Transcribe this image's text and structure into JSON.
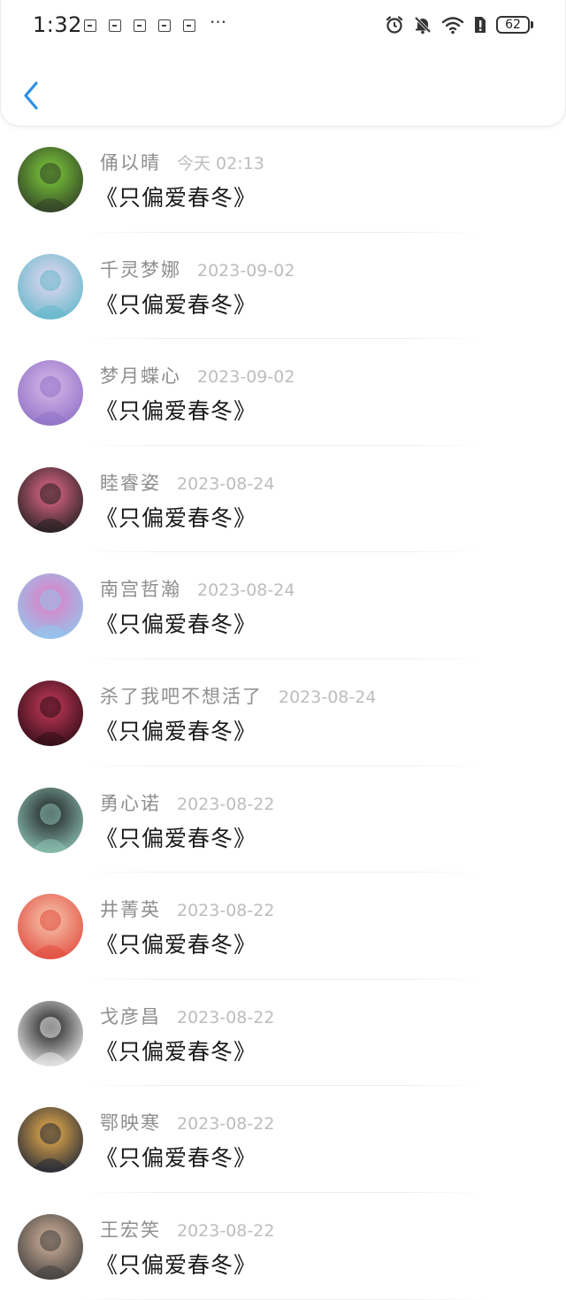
{
  "status_bar": {
    "time": "1:32",
    "battery": "62",
    "more": "···"
  },
  "nav": {
    "accent_color": "#2b8fe6"
  },
  "messages": [
    {
      "name": "俑以晴",
      "date": "今天 02:13",
      "text": "《只偏爱春冬》",
      "avatar_colors": [
        "#2d3a26",
        "#7fcf3a"
      ]
    },
    {
      "name": "千灵梦娜",
      "date": "2023-09-02",
      "text": "《只偏爱春冬》",
      "avatar_colors": [
        "#5fb7c9",
        "#e8d8f2"
      ]
    },
    {
      "name": "梦月蝶心",
      "date": "2023-09-02",
      "text": "《只偏爱春冬》",
      "avatar_colors": [
        "#8e6fc6",
        "#d9b8e8"
      ]
    },
    {
      "name": "睦睿姿",
      "date": "2023-08-24",
      "text": "《只偏爱春冬》",
      "avatar_colors": [
        "#1c1c1c",
        "#e86b8d"
      ]
    },
    {
      "name": "南宫哲瀚",
      "date": "2023-08-24",
      "text": "《只偏爱春冬》",
      "avatar_colors": [
        "#8ec9ef",
        "#e57ac2"
      ]
    },
    {
      "name": "杀了我吧不想活了",
      "date": "2023-08-24",
      "text": "《只偏爱春冬》",
      "avatar_colors": [
        "#2a0b14",
        "#c83a5a"
      ]
    },
    {
      "name": "勇心诺",
      "date": "2023-08-22",
      "text": "《只偏爱春冬》",
      "avatar_colors": [
        "#8fc7b8",
        "#1e1e1e"
      ]
    },
    {
      "name": "井菁英",
      "date": "2023-08-22",
      "text": "《只偏爱春冬》",
      "avatar_colors": [
        "#e2483c",
        "#f6c9b0"
      ]
    },
    {
      "name": "戈彦昌",
      "date": "2023-08-22",
      "text": "《只偏爱春冬》",
      "avatar_colors": [
        "#f2f2f2",
        "#1a1a1a"
      ]
    },
    {
      "name": "鄂映寒",
      "date": "2023-08-22",
      "text": "《只偏爱春冬》",
      "avatar_colors": [
        "#1b2436",
        "#f2b34c"
      ]
    },
    {
      "name": "王宏笑",
      "date": "2023-08-22",
      "text": "《只偏爱春冬》",
      "avatar_colors": [
        "#3b3b3b",
        "#d6b59c"
      ]
    }
  ]
}
